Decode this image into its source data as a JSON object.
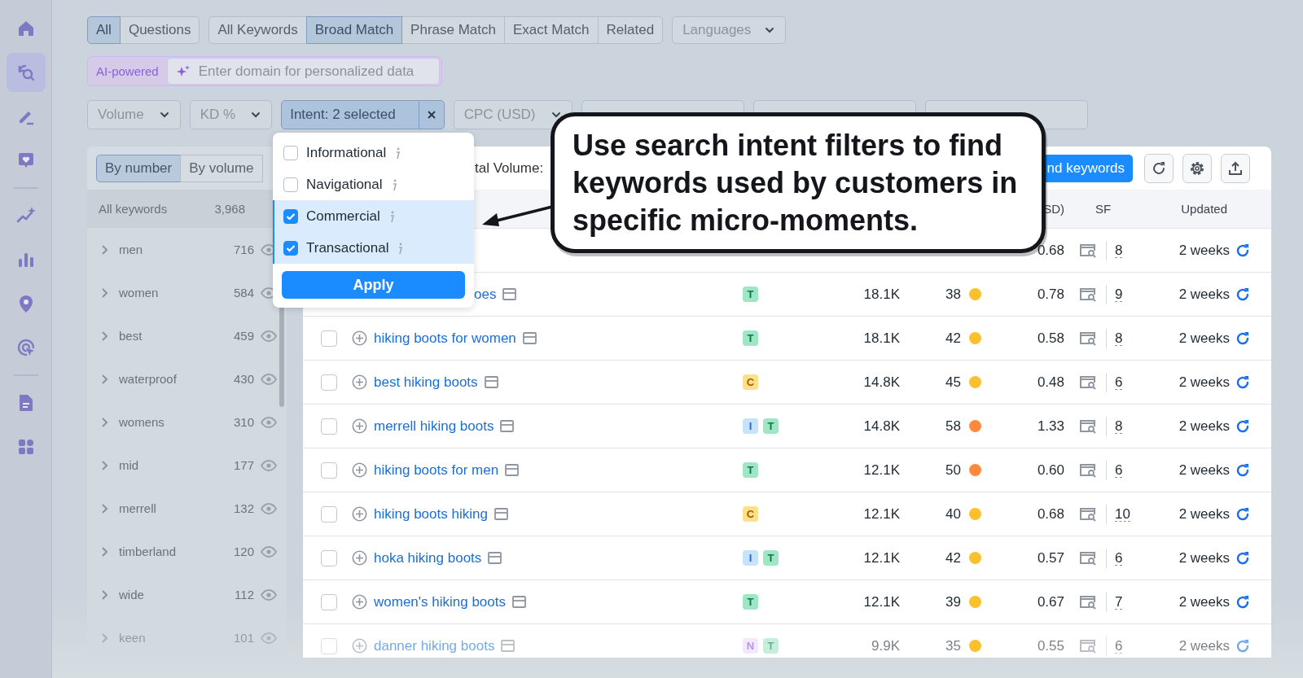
{
  "sidebar": {
    "groups": [
      {
        "items": [
          {
            "kind": "home",
            "selected": false
          },
          {
            "kind": "keyword-search",
            "selected": true
          },
          {
            "kind": "pencil",
            "selected": false
          },
          {
            "kind": "heart-chat",
            "selected": false
          }
        ]
      },
      {
        "items": [
          {
            "kind": "sparkle-trend",
            "selected": false
          },
          {
            "kind": "bar-chart",
            "selected": false
          },
          {
            "kind": "map-pin",
            "selected": false
          },
          {
            "kind": "cursor-target",
            "selected": false
          }
        ]
      },
      {
        "items": [
          {
            "kind": "document",
            "selected": false
          },
          {
            "kind": "apps",
            "selected": false
          }
        ]
      }
    ]
  },
  "question_tabs": [
    {
      "label": "All",
      "selected": true
    },
    {
      "label": "Questions",
      "selected": false
    }
  ],
  "match_tabs": [
    {
      "label": "All Keywords",
      "selected": false
    },
    {
      "label": "Broad Match",
      "selected": true
    },
    {
      "label": "Phrase Match",
      "selected": false
    },
    {
      "label": "Exact Match",
      "selected": false
    },
    {
      "label": "Related",
      "selected": false
    }
  ],
  "languages": {
    "label": "Languages"
  },
  "ai_field": {
    "badge": "AI-powered",
    "placeholder": "Enter domain for personalized data"
  },
  "filters": [
    {
      "label": "Volume",
      "active": false
    },
    {
      "label": "KD %",
      "active": false
    },
    {
      "label": "Intent: 2 selected",
      "active": true
    },
    {
      "label": "CPC (USD)",
      "active": false
    },
    {
      "active": false
    },
    {
      "active": false
    },
    {
      "active": false
    }
  ],
  "panel": {
    "view_tabs": [
      {
        "label": "By number",
        "selected": true
      },
      {
        "label": "By volume",
        "selected": false
      }
    ],
    "total": {
      "label": "All keywords",
      "count": "3,968"
    },
    "groups": [
      {
        "name": "men",
        "count": "716",
        "faded": false
      },
      {
        "name": "women",
        "count": "584",
        "faded": false
      },
      {
        "name": "best",
        "count": "459",
        "faded": false
      },
      {
        "name": "waterproof",
        "count": "430",
        "faded": false
      },
      {
        "name": "womens",
        "count": "310",
        "faded": false
      },
      {
        "name": "mid",
        "count": "177",
        "faded": false
      },
      {
        "name": "merrell",
        "count": "132",
        "faded": false
      },
      {
        "name": "timberland",
        "count": "120",
        "faded": false
      },
      {
        "name": "wide",
        "count": "112",
        "faded": false
      },
      {
        "name": "keen",
        "count": "101",
        "faded": true
      }
    ]
  },
  "table": {
    "toolbar": {
      "total_label": "tal Volume:",
      "add_button": "nd keywords"
    },
    "columns": [
      {
        "label": "SD)"
      },
      {
        "label": "SF"
      },
      {
        "label": "Updated"
      }
    ],
    "rows": [
      {
        "kind": "cut",
        "faded": false,
        "cpc": "0.68",
        "sf": "8",
        "updated": "2 weeks"
      },
      {
        "kind": "cut",
        "faded": false,
        "keyword": "oes",
        "intents": [
          {
            "letter": "T",
            "kind": "transactional"
          }
        ],
        "volume": "18.1K",
        "kd": "38",
        "color": "#fcc02e",
        "cpc": "0.78",
        "sf": "9",
        "updated": "2 weeks"
      },
      {
        "kind": "full",
        "faded": false,
        "keyword": "hiking boots for women",
        "intents": [
          {
            "letter": "T",
            "kind": "transactional"
          }
        ],
        "volume": "18.1K",
        "kd": "42",
        "color": "#fcc02e",
        "cpc": "0.58",
        "sf": "8",
        "updated": "2 weeks"
      },
      {
        "kind": "full",
        "faded": false,
        "keyword": "best hiking boots",
        "intents": [
          {
            "letter": "C",
            "kind": "commercial"
          }
        ],
        "volume": "14.8K",
        "kd": "45",
        "color": "#fcc02e",
        "cpc": "0.48",
        "sf": "6",
        "updated": "2 weeks"
      },
      {
        "kind": "full",
        "faded": false,
        "keyword": "merrell hiking boots",
        "intents": [
          {
            "letter": "I",
            "kind": "informational"
          },
          {
            "letter": "T",
            "kind": "transactional"
          }
        ],
        "volume": "14.8K",
        "kd": "58",
        "color": "#ff8a3d",
        "cpc": "1.33",
        "sf": "8",
        "updated": "2 weeks"
      },
      {
        "kind": "full",
        "faded": false,
        "keyword": "hiking boots for men",
        "intents": [
          {
            "letter": "T",
            "kind": "transactional"
          }
        ],
        "volume": "12.1K",
        "kd": "50",
        "color": "#ff8a3d",
        "cpc": "0.60",
        "sf": "6",
        "updated": "2 weeks"
      },
      {
        "kind": "full",
        "faded": false,
        "keyword": "hiking boots hiking",
        "intents": [
          {
            "letter": "C",
            "kind": "commercial"
          }
        ],
        "volume": "12.1K",
        "kd": "40",
        "color": "#fcc02e",
        "cpc": "0.68",
        "sf": "10",
        "updated": "2 weeks"
      },
      {
        "kind": "full",
        "faded": false,
        "keyword": "hoka hiking boots",
        "intents": [
          {
            "letter": "I",
            "kind": "informational"
          },
          {
            "letter": "T",
            "kind": "transactional"
          }
        ],
        "volume": "12.1K",
        "kd": "42",
        "color": "#fcc02e",
        "cpc": "0.57",
        "sf": "6",
        "updated": "2 weeks"
      },
      {
        "kind": "full",
        "faded": false,
        "keyword": "women's hiking boots",
        "intents": [
          {
            "letter": "T",
            "kind": "transactional"
          }
        ],
        "volume": "12.1K",
        "kd": "39",
        "color": "#fcc02e",
        "cpc": "0.67",
        "sf": "7",
        "updated": "2 weeks"
      },
      {
        "kind": "full",
        "faded": true,
        "keyword": "danner hiking boots",
        "intents": [
          {
            "letter": "N",
            "kind": "navigational"
          },
          {
            "letter": "T",
            "kind": "transactional"
          }
        ],
        "volume": "9.9K",
        "kd": "35",
        "color": "#fcc02e",
        "cpc": "0.55",
        "sf": "6",
        "updated": "2 weeks"
      }
    ]
  },
  "intent_menu": {
    "options": [
      {
        "label": "Informational",
        "checked": false
      },
      {
        "label": "Navigational",
        "checked": false
      },
      {
        "label": "Commercial",
        "checked": true
      },
      {
        "label": "Transactional",
        "checked": true
      }
    ],
    "apply": "Apply"
  },
  "callout": {
    "text": "Use search intent filters to find keywords used by customers in specific micro-moments."
  }
}
